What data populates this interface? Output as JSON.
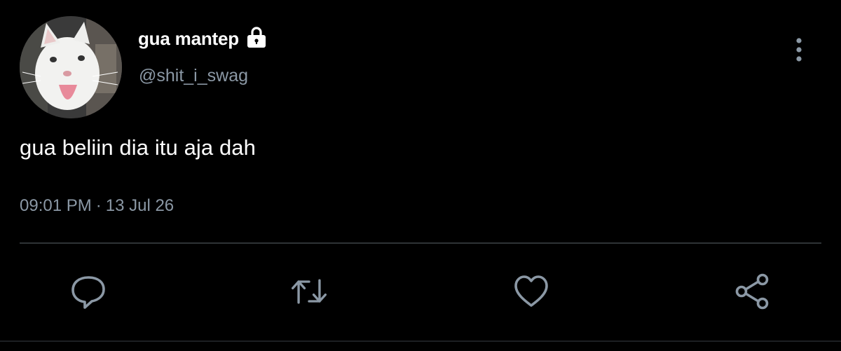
{
  "tweet": {
    "display_name": "gua mantep",
    "handle": "@shit_i_swag",
    "text": "gua beliin dia itu aja dah",
    "time": "09:01 PM",
    "separator": "·",
    "date": "13 Jul 26",
    "protected": true
  },
  "icons": {
    "avatar": "cat-avatar",
    "lock": "lock-icon",
    "more": "more-vertical-icon",
    "reply": "reply-icon",
    "retweet": "retweet-icon",
    "like": "heart-icon",
    "share": "share-icon"
  },
  "colors": {
    "background": "#000000",
    "primary_text": "#ffffff",
    "secondary_text": "#8b98a5",
    "icon": "#8b98a5",
    "divider": "#2f3336"
  }
}
